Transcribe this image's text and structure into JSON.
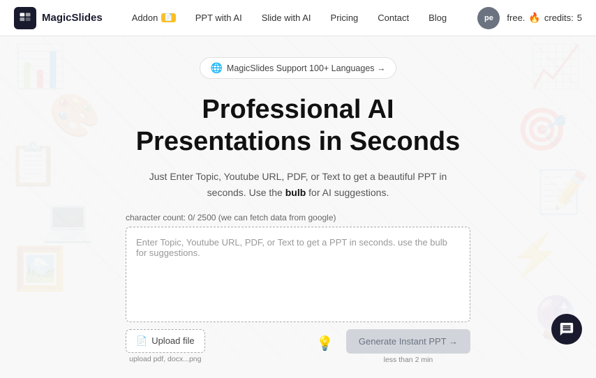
{
  "logo": {
    "text": "MagicSlides"
  },
  "nav": {
    "links": [
      {
        "label": "Addon",
        "hasBadge": true,
        "badgeEmoji": "📄"
      },
      {
        "label": "PPT with AI"
      },
      {
        "label": "Slide with AI"
      },
      {
        "label": "Pricing"
      },
      {
        "label": "Contact"
      },
      {
        "label": "Blog"
      }
    ]
  },
  "user": {
    "initials": "pe",
    "plan": "free.",
    "fire": "🔥",
    "credits_label": "credits:",
    "credits_count": "5"
  },
  "hero": {
    "pill_icon": "🌐",
    "pill_text": "MagicSlides Support 100+ Languages →",
    "title_line1": "Professional AI",
    "title_line2": "Presentations in Seconds",
    "subtitle_before": "Just Enter Topic, Youtube URL, PDF, or Text to get a beautiful PPT in seconds. Use the",
    "subtitle_bold": "bulb",
    "subtitle_after": "for AI suggestions."
  },
  "input_area": {
    "char_count_label": "character count: 0/ 2500 (we can fetch data from google)",
    "placeholder": "Enter Topic, Youtube URL, PDF, or Text to get a PPT in seconds. use the bulb for suggestions."
  },
  "actions": {
    "upload_label": "Upload file",
    "upload_hint": "upload pdf, docx...png",
    "bulb_icon": "💡",
    "generate_label": "Generate Instant PPT →",
    "generate_hint": "less than 2 min"
  },
  "chat": {
    "icon": "chat"
  }
}
